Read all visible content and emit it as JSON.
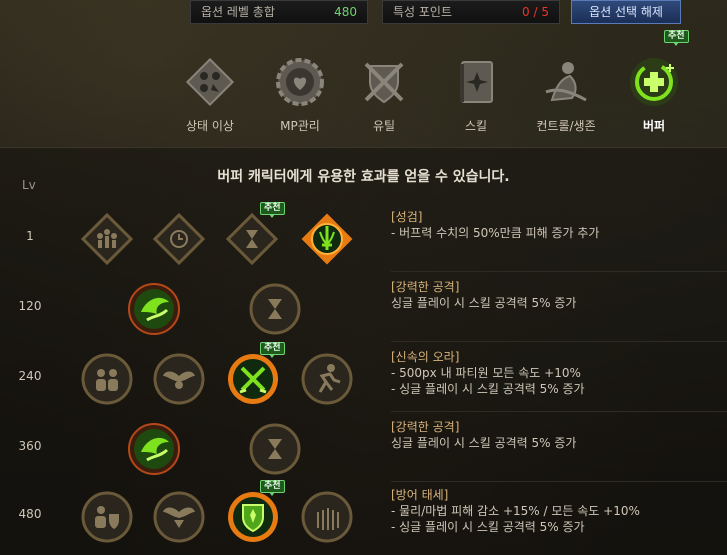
{
  "topbar": {
    "level_total_label": "옵션 레벨 총합",
    "level_total_value": "480",
    "trait_points_label": "특성 포인트",
    "trait_points_value": "0 / 5",
    "reset_button_label": "옵션 선택 해제"
  },
  "recommend_badge": "추천",
  "tabs": [
    {
      "label": "상태 이상",
      "icon": "status-effect-icon",
      "active": false
    },
    {
      "label": "MP관리",
      "icon": "mp-management-icon",
      "active": false
    },
    {
      "label": "유틸",
      "icon": "utility-icon",
      "active": false
    },
    {
      "label": "스킬",
      "icon": "skill-book-icon",
      "active": false
    },
    {
      "label": "컨트롤/생존",
      "icon": "control-survival-icon",
      "active": false
    },
    {
      "label": "버퍼",
      "icon": "buffer-icon",
      "active": true
    }
  ],
  "panel": {
    "description": "버퍼 캐릭터에게 유용한 효과를 얻을 수 있습니다.",
    "level_header": "Lv"
  },
  "rows": [
    {
      "level": "1",
      "title": "[성검]",
      "lines": [
        "- 버프력 수치의 50%만큼 피해 증가 추가"
      ]
    },
    {
      "level": "120",
      "title": "[강력한 공격]",
      "lines": [
        "싱글 플레이 시 스킬 공격력 5% 증가"
      ]
    },
    {
      "level": "240",
      "title": "[신속의 오라]",
      "lines": [
        "- 500px 내 파티원 모든 속도 +10%",
        "- 싱글 플레이 시 스킬 공격력 5% 증가"
      ]
    },
    {
      "level": "360",
      "title": "[강력한 공격]",
      "lines": [
        "싱글 플레이 시 스킬 공격력 5% 증가"
      ]
    },
    {
      "level": "480",
      "title": "[방어 태세]",
      "lines": [
        "- 물리/마법 피해 감소 +15% / 모든 속도 +10%",
        "- 싱글 플레이 시 스킬 공격력 5% 증가"
      ]
    }
  ],
  "colors": {
    "accent_green": "#7ee21f",
    "selected_ring": "#e87a12",
    "title_gold": "#d7b37a",
    "red_value": "#e8352b",
    "green_value": "#6fd36f"
  }
}
